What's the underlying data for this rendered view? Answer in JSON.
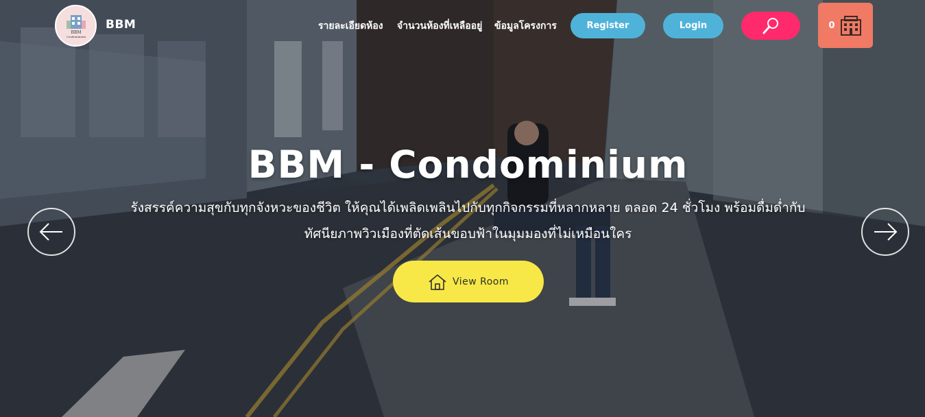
{
  "brand": {
    "name": "BBM",
    "logo_icon": "building-logo-icon"
  },
  "nav": {
    "links": [
      "รายละเอียดห้อง",
      "จำนวนห้องที่เหลืออยู่",
      "ข้อมูลโครงการ"
    ],
    "register_label": "Register",
    "login_label": "Login",
    "search_icon": "magnifier-icon",
    "cart_count": "0",
    "cart_icon": "building-icon"
  },
  "hero": {
    "title": "BBM - Condominium",
    "subtitle_line1": "รังสรรค์ความสุขกับทุกจังหวะของชีวิต ให้คุณได้เพลิดเพลินไปกับทุกกิจกรรมที่หลากหลาย ตลอด 24 ชั่วโมง พร้อมดื่มด่ำกับ",
    "subtitle_line2": "ทัศนียภาพวิวเมืองที่ตัดเส้นขอบฟ้าในมุมมองที่ไม่เหมือนใคร",
    "view_button_label": "View Room",
    "view_button_icon": "house-icon",
    "prev_icon": "arrow-left-icon",
    "next_icon": "arrow-right-icon"
  },
  "colors": {
    "register": "#4fb3d9",
    "login": "#4fb3d9",
    "search": "#ff2a6c",
    "cart": "#f07a64",
    "view_button": "#f7e847"
  }
}
